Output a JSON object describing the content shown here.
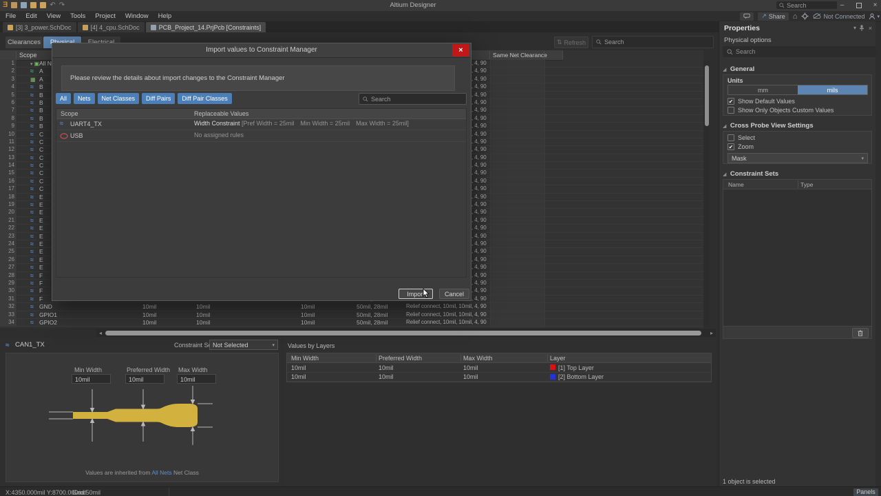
{
  "titlebar": {
    "app": "Altium Designer",
    "search_placeholder": "Search"
  },
  "menubar": {
    "items": [
      "File",
      "Edit",
      "View",
      "Tools",
      "Project",
      "Window",
      "Help"
    ]
  },
  "topright": {
    "share": "Share",
    "not_connected": "Not Connected"
  },
  "doc_tabs": {
    "tab1": "[3] 3_power.SchDoc",
    "tab2": "[4] 4_cpu.SchDoc",
    "tab3": "PCB_Project_14.PrjPcb [Constraints]"
  },
  "view_tabs": {
    "clearances": "Clearances",
    "physical": "Physical",
    "electrical": "Electrical"
  },
  "grid_toolbar": {
    "refresh": "Refresh",
    "search_placeholder": "Search"
  },
  "grid": {
    "scope_header": "Scope",
    "same_net_header": "Same Net Clearance",
    "row_cells": [
      "10mil",
      "10mil",
      "10mil",
      "50mil, 28mil",
      "Relief connect, 10mil, 10mil, 4, 90"
    ],
    "rows": [
      {
        "n": "1",
        "name": "All Ne",
        "icon": "allnets"
      },
      {
        "n": "2",
        "name": "A",
        "icon": "netclass"
      },
      {
        "n": "3",
        "name": "A",
        "icon": "gridnet"
      },
      {
        "n": "4",
        "name": "B",
        "icon": "net"
      },
      {
        "n": "5",
        "name": "B",
        "icon": "net"
      },
      {
        "n": "6",
        "name": "B",
        "icon": "net"
      },
      {
        "n": "7",
        "name": "B",
        "icon": "net"
      },
      {
        "n": "8",
        "name": "B",
        "icon": "net"
      },
      {
        "n": "9",
        "name": "B",
        "icon": "net"
      },
      {
        "n": "10",
        "name": "C",
        "icon": "net"
      },
      {
        "n": "11",
        "name": "C",
        "icon": "net"
      },
      {
        "n": "12",
        "name": "C",
        "icon": "net"
      },
      {
        "n": "13",
        "name": "C",
        "icon": "net"
      },
      {
        "n": "14",
        "name": "C",
        "icon": "net"
      },
      {
        "n": "15",
        "name": "C",
        "icon": "net"
      },
      {
        "n": "16",
        "name": "C",
        "icon": "net"
      },
      {
        "n": "17",
        "name": "C",
        "icon": "net"
      },
      {
        "n": "18",
        "name": "E",
        "icon": "net"
      },
      {
        "n": "19",
        "name": "E",
        "icon": "net"
      },
      {
        "n": "20",
        "name": "E",
        "icon": "net"
      },
      {
        "n": "21",
        "name": "E",
        "icon": "net"
      },
      {
        "n": "22",
        "name": "E",
        "icon": "net"
      },
      {
        "n": "23",
        "name": "E",
        "icon": "net"
      },
      {
        "n": "24",
        "name": "E",
        "icon": "net"
      },
      {
        "n": "25",
        "name": "E",
        "icon": "net"
      },
      {
        "n": "26",
        "name": "E",
        "icon": "net"
      },
      {
        "n": "27",
        "name": "E",
        "icon": "net"
      },
      {
        "n": "28",
        "name": "F",
        "icon": "net"
      },
      {
        "n": "29",
        "name": "F",
        "icon": "net"
      },
      {
        "n": "30",
        "name": "F",
        "icon": "net"
      },
      {
        "n": "31",
        "name": "F",
        "icon": "net"
      },
      {
        "n": "32",
        "name": "GND",
        "icon": "net"
      },
      {
        "n": "33",
        "name": "GPIO1",
        "icon": "net"
      },
      {
        "n": "34",
        "name": "GPIO2",
        "icon": "net"
      }
    ]
  },
  "dialog": {
    "title": "Import values to Constraint Manager",
    "message": "Please review the details about import changes to the Constraint Manager",
    "filters": [
      "All",
      "Nets",
      "Net Classes",
      "Diff Pairs",
      "Diff Pair Classes"
    ],
    "search_placeholder": "Search",
    "col_scope": "Scope",
    "col_values": "Replaceable Values",
    "row1": {
      "name": "UART4_TX",
      "value_main": "Width Constraint",
      "value_detail": "[Pref Width = 25mil Min Width = 25mil Max Width = 25mil]"
    },
    "row2": {
      "name": "USB",
      "value_detail": "No assigned rules"
    },
    "import_label": "Import",
    "cancel_label": "Cancel"
  },
  "properties": {
    "title": "Properties",
    "subtitle": "Physical options",
    "search_placeholder": "Search",
    "general": {
      "label": "General",
      "units_label": "Units",
      "unit_mm": "mm",
      "unit_mils": "mils",
      "cb_default": "Show Default Values",
      "cb_custom": "Show Only Objects Custom Values"
    },
    "cross_probe": {
      "label": "Cross Probe View Settings",
      "cb_select": "Select",
      "cb_zoom": "Zoom",
      "mask_value": "Mask"
    },
    "constraint_sets": {
      "label": "Constraint Sets",
      "col_name": "Name",
      "col_type": "Type"
    },
    "status": "1 object is selected"
  },
  "preview": {
    "net": "CAN1_TX",
    "constraint_set_label": "Constraint Set",
    "constraint_set_value": "Not Selected",
    "min_label": "Min Width",
    "min_value": "10mil",
    "pref_label": "Preferred Width",
    "pref_value": "10mil",
    "max_label": "Max Width",
    "max_value": "10mil",
    "footer_prefix": "Values are inherited from ",
    "footer_link": "All Nets",
    "footer_suffix": " Net Class",
    "trace_color": "#d2b13e"
  },
  "values_by_layers": {
    "title": "Values by Layers",
    "col_min": "Min Width",
    "col_pref": "Preferred Width",
    "col_max": "Max Width",
    "col_layer": "Layer",
    "row1": {
      "min": "10mil",
      "pref": "10mil",
      "max": "10mil",
      "layer": "[1] Top Layer",
      "color": "#dd1111"
    },
    "row2": {
      "min": "10mil",
      "pref": "10mil",
      "max": "10mil",
      "layer": "[2] Bottom Layer",
      "color": "#2233dd"
    }
  },
  "statusbar": {
    "coords": "X:4350.000mil Y:8700.000mil",
    "grid": "Grid:50mil",
    "panels": "Panels"
  }
}
